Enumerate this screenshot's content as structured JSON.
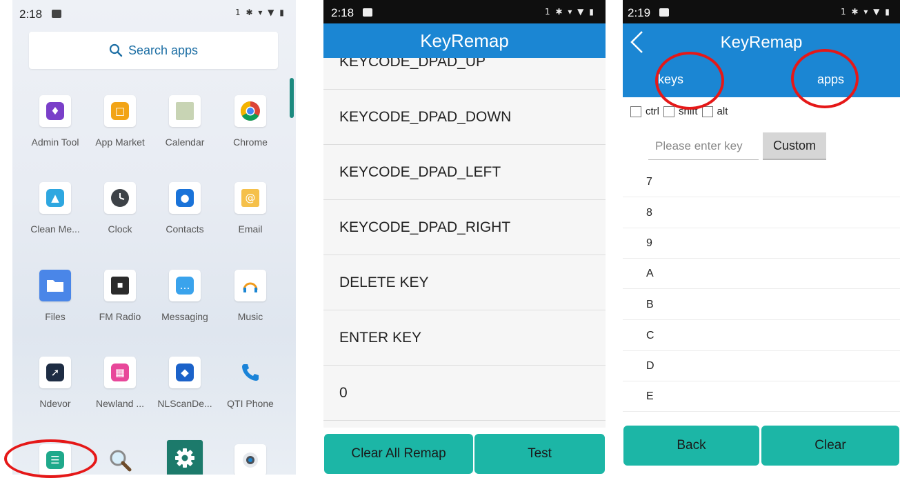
{
  "launcher": {
    "time": "2:18",
    "status_icons": "1 ✱ ▾ ▼ ▮",
    "search_label": "Search apps",
    "apps": [
      {
        "label": "Admin Tool",
        "icon": "admin-tool-icon"
      },
      {
        "label": "App Market",
        "icon": "app-market-icon"
      },
      {
        "label": "Calendar",
        "icon": "calendar-icon"
      },
      {
        "label": "Chrome",
        "icon": "chrome-icon"
      },
      {
        "label": "Clean Me...",
        "icon": "clean-master-icon"
      },
      {
        "label": "Clock",
        "icon": "clock-icon"
      },
      {
        "label": "Contacts",
        "icon": "contacts-icon"
      },
      {
        "label": "Email",
        "icon": "email-icon"
      },
      {
        "label": "Files",
        "icon": "files-icon"
      },
      {
        "label": "FM Radio",
        "icon": "fm-radio-icon"
      },
      {
        "label": "Messaging",
        "icon": "messaging-icon"
      },
      {
        "label": "Music",
        "icon": "music-icon"
      },
      {
        "label": "Ndevor",
        "icon": "ndevor-icon"
      },
      {
        "label": "Newland ...",
        "icon": "newland-icon"
      },
      {
        "label": "NLScanDe...",
        "icon": "nlscan-icon"
      },
      {
        "label": "QTI Phone",
        "icon": "phone-icon"
      },
      {
        "label": "",
        "icon": "keyremap-icon"
      },
      {
        "label": "",
        "icon": "search-icon"
      },
      {
        "label": "",
        "icon": "settings-icon"
      },
      {
        "label": "",
        "icon": "camera-icon"
      }
    ]
  },
  "keyremap_list": {
    "time": "2:18",
    "status_icons": "1 ✱ ▾ ▼ ▮",
    "title": "KeyRemap",
    "partial_item": "KEYCODE_DPAD_UP",
    "items": [
      "KEYCODE_DPAD_DOWN",
      "KEYCODE_DPAD_LEFT",
      "KEYCODE_DPAD_RIGHT",
      "DELETE KEY",
      "ENTER KEY",
      "0"
    ],
    "clear_all_label": "Clear All Remap",
    "test_label": "Test"
  },
  "keyremap_edit": {
    "time": "2:19",
    "status_icons": "1 ✱ ▾ ▼ ▮",
    "title": "KeyRemap",
    "tab_keys": "keys",
    "tab_apps": "apps",
    "mod_ctrl": "ctrl",
    "mod_shift": "shift",
    "mod_alt": "alt",
    "input_placeholder": "Please enter key",
    "custom_label": "Custom",
    "keys": [
      "7",
      "8",
      "9",
      "A",
      "B",
      "C",
      "D",
      "E"
    ],
    "back_label": "Back",
    "clear_label": "Clear"
  },
  "colors": {
    "header_blue": "#1b86d3",
    "button_teal": "#1cb6a6",
    "annotation_red": "#e51818"
  }
}
